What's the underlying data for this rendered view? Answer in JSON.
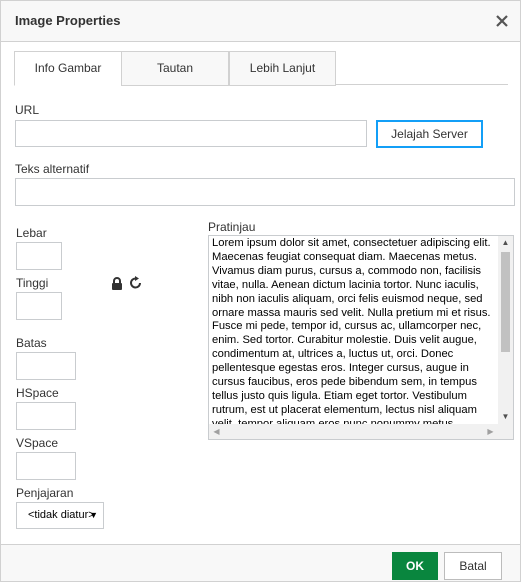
{
  "dialog": {
    "title": "Image Properties",
    "close_icon": "close-icon"
  },
  "tabs": [
    {
      "label": "Info Gambar",
      "active": true
    },
    {
      "label": "Tautan",
      "active": false
    },
    {
      "label": "Lebih Lanjut",
      "active": false
    }
  ],
  "url": {
    "label": "URL",
    "value": "",
    "browse_button": "Jelajah Server"
  },
  "alt": {
    "label": "Teks alternatif",
    "value": ""
  },
  "width": {
    "label": "Lebar",
    "value": ""
  },
  "height": {
    "label": "Tinggi",
    "value": ""
  },
  "lock_icon": "lock-icon",
  "reset_icon": "reset-size-icon",
  "border": {
    "label": "Batas",
    "value": ""
  },
  "hspace": {
    "label": "HSpace",
    "value": ""
  },
  "vspace": {
    "label": "VSpace",
    "value": ""
  },
  "alignment": {
    "label": "Penjajaran",
    "selected": "<tidak diatur>"
  },
  "preview": {
    "label": "Pratinjau",
    "text": "Lorem ipsum dolor sit amet, consectetuer adipiscing elit. Maecenas feugiat consequat diam. Maecenas metus. Vivamus diam purus, cursus a, commodo non, facilisis vitae, nulla. Aenean dictum lacinia tortor. Nunc iaculis, nibh non iaculis aliquam, orci felis euismod neque, sed ornare massa mauris sed velit. Nulla pretium mi et risus. Fusce mi pede, tempor id, cursus ac, ullamcorper nec, enim. Sed tortor. Curabitur molestie. Duis velit augue, condimentum at, ultrices a, luctus ut, orci. Donec pellentesque egestas eros. Integer cursus, augue in cursus faucibus, eros pede bibendum sem, in tempus tellus justo quis ligula. Etiam eget tortor. Vestibulum rutrum, est ut placerat elementum, lectus nisl aliquam velit, tempor aliquam eros nunc nonummy metus."
  },
  "footer": {
    "ok": "OK",
    "cancel": "Batal"
  },
  "colors": {
    "ok_button": "#09863e",
    "focus_outline": "#139ff7"
  }
}
